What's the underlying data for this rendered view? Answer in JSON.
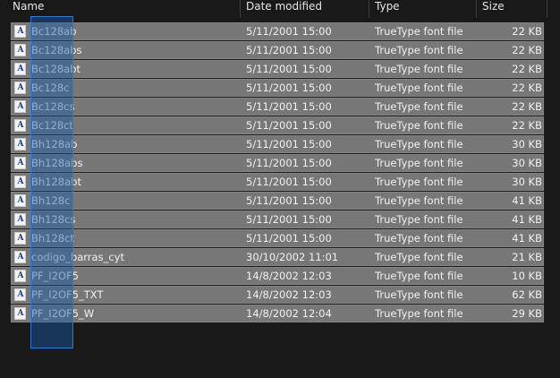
{
  "header": {
    "name_label": "Name",
    "date_label": "Date modified",
    "type_label": "Type",
    "size_label": "Size"
  },
  "files": [
    {
      "name": "Bc128ab",
      "date": "5/11/2001 15:00",
      "type": "TrueType font file",
      "size": "22 KB"
    },
    {
      "name": "Bc128abs",
      "date": "5/11/2001 15:00",
      "type": "TrueType font file",
      "size": "22 KB"
    },
    {
      "name": "Bc128abt",
      "date": "5/11/2001 15:00",
      "type": "TrueType font file",
      "size": "22 KB"
    },
    {
      "name": "Bc128c",
      "date": "5/11/2001 15:00",
      "type": "TrueType font file",
      "size": "22 KB"
    },
    {
      "name": "Bc128cs",
      "date": "5/11/2001 15:00",
      "type": "TrueType font file",
      "size": "22 KB"
    },
    {
      "name": "Bc128ct",
      "date": "5/11/2001 15:00",
      "type": "TrueType font file",
      "size": "22 KB"
    },
    {
      "name": "Bh128ab",
      "date": "5/11/2001 15:00",
      "type": "TrueType font file",
      "size": "30 KB"
    },
    {
      "name": "Bh128abs",
      "date": "5/11/2001 15:00",
      "type": "TrueType font file",
      "size": "30 KB"
    },
    {
      "name": "Bh128abt",
      "date": "5/11/2001 15:00",
      "type": "TrueType font file",
      "size": "30 KB"
    },
    {
      "name": "Bh128c",
      "date": "5/11/2001 15:00",
      "type": "TrueType font file",
      "size": "41 KB"
    },
    {
      "name": "Bh128cs",
      "date": "5/11/2001 15:00",
      "type": "TrueType font file",
      "size": "41 KB"
    },
    {
      "name": "Bh128ct",
      "date": "5/11/2001 15:00",
      "type": "TrueType font file",
      "size": "41 KB"
    },
    {
      "name": "codigo_barras_cyt",
      "date": "30/10/2002 11:01",
      "type": "TrueType font file",
      "size": "21 KB"
    },
    {
      "name": "PF_I2OF5",
      "date": "14/8/2002 12:03",
      "type": "TrueType font file",
      "size": "10 KB"
    },
    {
      "name": "PF_I2OF5_TXT",
      "date": "14/8/2002 12:03",
      "type": "TrueType font file",
      "size": "62 KB"
    },
    {
      "name": "PF_I2OF5_W",
      "date": "14/8/2002 12:04",
      "type": "TrueType font file",
      "size": "29 KB"
    }
  ],
  "icon": {
    "name": "font-file-icon",
    "glyph": "A",
    "glyph_color": "#1e3f8f"
  },
  "colors": {
    "background": "#191919",
    "row_selected": "#777777",
    "selection_rect": "#2d7ad6"
  }
}
